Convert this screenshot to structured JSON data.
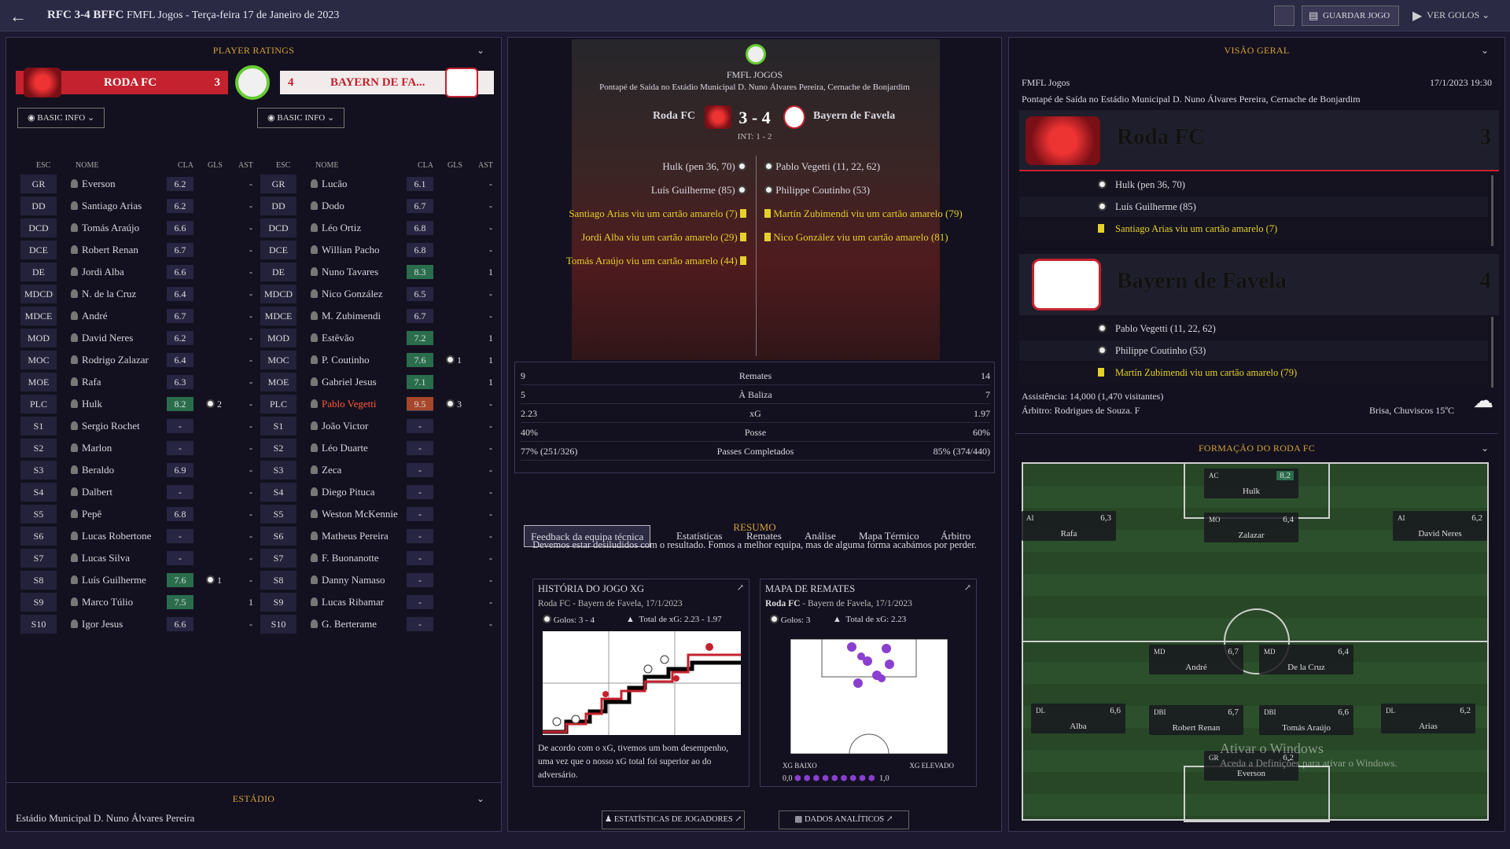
{
  "header": {
    "title_score": "RFC 3-4 BFFC",
    "title_rest": "FMFL Jogos - Terça-feira 17 de Janeiro de 2023",
    "save_label": "GUARDAR JOGO",
    "goals_label": "VER GOLOS"
  },
  "ratings": {
    "title": "PLAYER RATINGS",
    "home_name": "RODA FC",
    "home_score": "3",
    "away_score": "4",
    "away_name": "BAYERN DE FA...",
    "basic_info": "BASIC INFO",
    "cols": {
      "pos": "ESC",
      "name": "NOME",
      "cla": "CLA",
      "gls": "GLS",
      "ast": "AST"
    },
    "home": [
      [
        "GR",
        "Everson",
        "6.2",
        "",
        "-"
      ],
      [
        "DD",
        "Santiago Arias",
        "6.2",
        "",
        "-"
      ],
      [
        "DCD",
        "Tomás Araújo",
        "6.6",
        "",
        "-"
      ],
      [
        "DCE",
        "Robert Renan",
        "6.7",
        "",
        "-"
      ],
      [
        "DE",
        "Jordi Alba",
        "6.6",
        "",
        "-"
      ],
      [
        "MDCD",
        "N. de la Cruz",
        "6.4",
        "",
        "-"
      ],
      [
        "MDCE",
        "André",
        "6.7",
        "",
        "-"
      ],
      [
        "MOD",
        "David Neres",
        "6.2",
        "",
        "-"
      ],
      [
        "MOC",
        "Rodrigo Zalazar",
        "6.4",
        "",
        "-"
      ],
      [
        "MOE",
        "Rafa",
        "6.3",
        "",
        "-"
      ],
      [
        "PLC",
        "Hulk",
        "8.2",
        "2",
        "-"
      ],
      [
        "S1",
        "Sergio Rochet",
        "-",
        "",
        "-"
      ],
      [
        "S2",
        "Marlon",
        "-",
        "",
        "-"
      ],
      [
        "S3",
        "Beraldo",
        "6.9",
        "",
        "-"
      ],
      [
        "S4",
        "Dalbert",
        "-",
        "",
        "-"
      ],
      [
        "S5",
        "Pepê",
        "6.8",
        "",
        "-"
      ],
      [
        "S6",
        "Lucas Robertone",
        "-",
        "",
        "-"
      ],
      [
        "S7",
        "Lucas Silva",
        "-",
        "",
        "-"
      ],
      [
        "S8",
        "Luís Guilherme",
        "7.6",
        "1",
        "-"
      ],
      [
        "S9",
        "Marco Túlio",
        "7.5",
        "",
        "1"
      ],
      [
        "S10",
        "Igor Jesus",
        "6.6",
        "",
        "-"
      ]
    ],
    "away": [
      [
        "GR",
        "Lucão",
        "6.1",
        "",
        "-"
      ],
      [
        "DD",
        "Dodo",
        "6.7",
        "",
        "-"
      ],
      [
        "DCD",
        "Léo Ortiz",
        "6.8",
        "",
        "-"
      ],
      [
        "DCE",
        "Willian Pacho",
        "6.8",
        "",
        "-"
      ],
      [
        "DE",
        "Nuno Tavares",
        "8.3",
        "",
        "1"
      ],
      [
        "MDCD",
        "Nico González",
        "6.5",
        "",
        "-"
      ],
      [
        "MDCE",
        "M. Zubimendi",
        "6.7",
        "",
        "-"
      ],
      [
        "MOD",
        "Estêvão",
        "7.2",
        "",
        "1"
      ],
      [
        "MOC",
        "P. Coutinho",
        "7.6",
        "1",
        "1"
      ],
      [
        "MOE",
        "Gabriel Jesus",
        "7.1",
        "",
        "1"
      ],
      [
        "PLC",
        "Pablo Vegetti",
        "9.5",
        "3",
        "-"
      ],
      [
        "S1",
        "João Victor",
        "-",
        "",
        "-"
      ],
      [
        "S2",
        "Léo Duarte",
        "-",
        "",
        "-"
      ],
      [
        "S3",
        "Zeca",
        "-",
        "",
        "-"
      ],
      [
        "S4",
        "Diego Pituca",
        "-",
        "",
        "-"
      ],
      [
        "S5",
        "Weston McKennie",
        "-",
        "",
        "-"
      ],
      [
        "S6",
        "Matheus Pereira",
        "-",
        "",
        "-"
      ],
      [
        "S7",
        "F. Buonanotte",
        "-",
        "",
        "-"
      ],
      [
        "S8",
        "Danny Namaso",
        "-",
        "",
        "-"
      ],
      [
        "S9",
        "Lucas Ribamar",
        "-",
        "",
        "-"
      ],
      [
        "S10",
        "G. Berterame",
        "-",
        "",
        "-"
      ]
    ]
  },
  "stadium": {
    "title": "ESTÁDIO",
    "name": "Estádio Municipal D. Nuno Álvares Pereira"
  },
  "match": {
    "comp": "FMFL JOGOS",
    "kickoff": "Pontapé de Saída no Estádio Municipal D. Nuno Álvares Pereira, Cernache de Bonjardim",
    "home": "Roda FC",
    "away": "Bayern de Favela",
    "score": "3 - 4",
    "ht": "INT: 1 - 2",
    "home_events": [
      "Hulk (pen 36, 70)",
      "Luís Guilherme (85)",
      "Santiago Arias viu um cartão amarelo (7)",
      "Jordi Alba viu um cartão amarelo (29)",
      "Tomás Araújo viu um cartão amarelo (44)"
    ],
    "away_events": [
      "Pablo Vegetti (11, 22, 62)",
      "Philippe Coutinho (53)",
      "Martín Zubimendi viu um cartão amarelo (79)",
      "Nico González viu um cartão amarelo (81)"
    ]
  },
  "stats": [
    [
      "9",
      "Remates",
      "14"
    ],
    [
      "5",
      "À Baliza",
      "7"
    ],
    [
      "2.23",
      "xG",
      "1.97"
    ],
    [
      "40%",
      "Posse",
      "60%"
    ],
    [
      "77% (251/326)",
      "Passes Completados",
      "85% (374/440)"
    ]
  ],
  "tabs": [
    "Feedback da equipa técnica",
    "Estatísticas",
    "Remates",
    "Análise",
    "Mapa Térmico",
    "Árbitro"
  ],
  "summary": {
    "title": "RESUMO",
    "text": "Devemos estar desiludidos com o resultado. Fomos a melhor equipa, mas de alguma forma acabámos por perder."
  },
  "xg": {
    "title": "HISTÓRIA DO JOGO XG",
    "sub": "Roda FC - Bayern de Favela, 17/1/2023",
    "goals": "Golos: 3 - 4",
    "total": "Total de xG: 2.23 - 1.97",
    "text": "De acordo com o xG, tivemos um bom desempenho, uma vez que o nosso xG total foi superior ao do adversário."
  },
  "shots": {
    "title": "MAPA DE REMATES",
    "team": "Roda FC",
    "sub": " - Bayern de Favela, 17/1/2023",
    "goals": "Golos: 3",
    "total": "Total de xG: 2.23",
    "low": "XG BAIXO",
    "high": "XG ELEVADO",
    "min": "0,0",
    "max": "1,0"
  },
  "buttons": {
    "players": "ESTATÍSTICAS DE JOGADORES",
    "analytics": "DADOS ANALÍTICOS"
  },
  "overview": {
    "title": "VISÃO GERAL",
    "comp": "FMFL Jogos",
    "date": "17/1/2023 19:30",
    "kickoff": "Pontapé de Saída no Estádio Municipal D. Nuno Álvares Pereira, Cernache de Bonjardim",
    "home": "Roda FC",
    "home_score": "3",
    "away": "Bayern de Favela",
    "away_score": "4",
    "home_events": [
      "Hulk (pen 36, 70)",
      "Luís Guilherme (85)",
      "Santiago Arias viu um cartão amarelo (7)"
    ],
    "away_events": [
      "Pablo Vegetti (11, 22, 62)",
      "Philippe Coutinho (53)",
      "Martín Zubimendi viu um cartão amarelo (79)"
    ],
    "attendance": "Assistência: 14,000 (1,470 visitantes)",
    "referee": "Árbitro: Rodrigues de Souza. F",
    "weather": "Brisa, Chuviscos 15ºC"
  },
  "formation": {
    "title": "FORMAÇÃO DO RODA FC",
    "players": [
      [
        "AC",
        "8,2",
        "Hulk"
      ],
      [
        "AI",
        "6,3",
        "Rafa"
      ],
      [
        "MO",
        "6,4",
        "Zalazar"
      ],
      [
        "AI",
        "6,2",
        "David Neres"
      ],
      [
        "MD",
        "6,7",
        "André"
      ],
      [
        "MD",
        "6,4",
        "De la Cruz"
      ],
      [
        "DL",
        "6,6",
        "Alba"
      ],
      [
        "DBI",
        "6,7",
        "Robert Renan"
      ],
      [
        "DBI",
        "6,6",
        "Tomás Araújo"
      ],
      [
        "DL",
        "6,2",
        "Arias"
      ],
      [
        "GR",
        "6,2",
        "Everson"
      ]
    ]
  },
  "watermark": {
    "l1": "Ativar o Windows",
    "l2": "Aceda a Definições para ativar o Windows."
  },
  "colors": {
    "accent": "#d4a13a",
    "home": "#c4222e",
    "good": "#2a6d4c",
    "yellow": "#e6d12b"
  }
}
